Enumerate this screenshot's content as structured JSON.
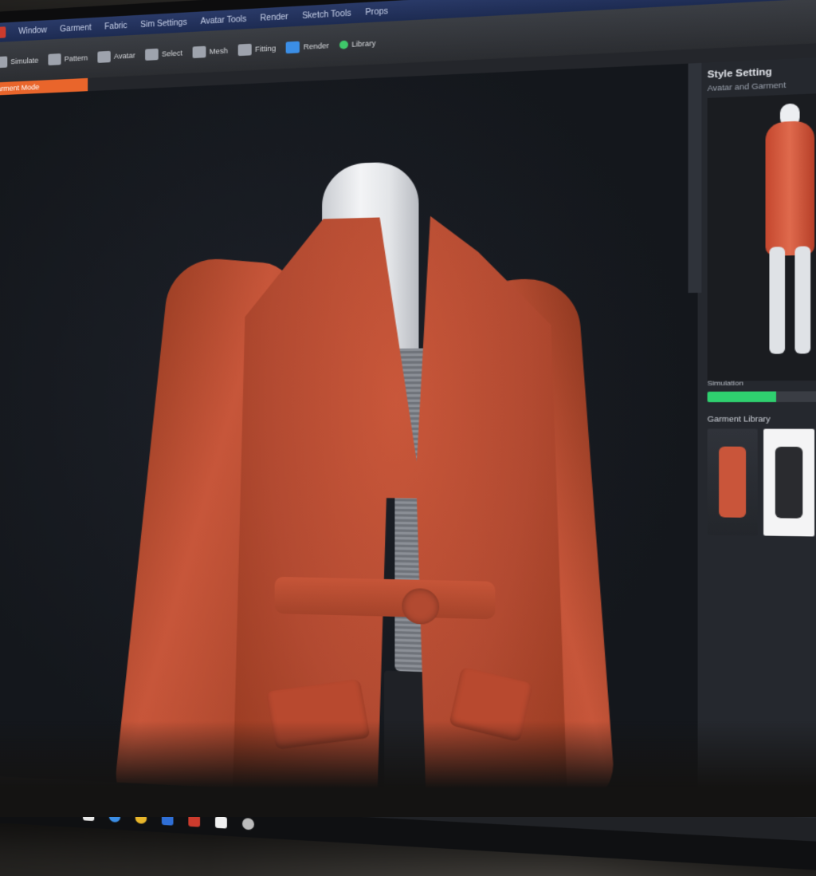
{
  "app": {
    "menu": [
      "Window",
      "Garment",
      "Fabric",
      "Sim Settings",
      "Avatar Tools",
      "Render",
      "Sketch Tools",
      "Props"
    ],
    "toolbar": [
      {
        "label": "Simulate",
        "icon": "simulate-icon"
      },
      {
        "label": "Pattern",
        "icon": "pattern-icon"
      },
      {
        "label": "Avatar",
        "icon": "avatar-icon"
      },
      {
        "label": "Select",
        "icon": "select-icon"
      },
      {
        "label": "Mesh",
        "icon": "mesh-icon"
      },
      {
        "label": "Fitting",
        "icon": "fitting-icon"
      },
      {
        "label": "Render",
        "icon": "render-icon"
      },
      {
        "label": "Library",
        "icon": "library-icon"
      }
    ],
    "active_tab": "Garment Mode"
  },
  "right_panel": {
    "title": "Style Setting",
    "subtitle": "Avatar and Garment",
    "progress_label": "Simulation",
    "progress_fraction": 0.42,
    "library_title": "Garment Library",
    "thumbnails": [
      {
        "name": "thumb-cardigan",
        "color": "#c9553a"
      },
      {
        "name": "thumb-dark-dress",
        "color": "#2a2b2f"
      },
      {
        "name": "thumb-red-print",
        "color": "#b83a35"
      }
    ]
  },
  "colors": {
    "cardigan": "#c9553a",
    "progress": "#2fd06f",
    "accent_tab": "#e9652b"
  }
}
